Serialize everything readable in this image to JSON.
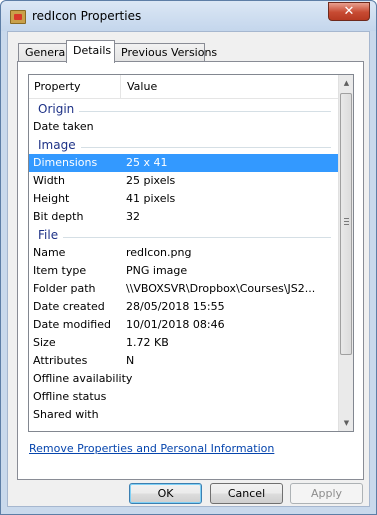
{
  "window": {
    "title": "redIcon Properties",
    "close_glyph": "✕"
  },
  "tabs": [
    {
      "label": "General"
    },
    {
      "label": "Details"
    },
    {
      "label": "Previous Versions"
    }
  ],
  "columns": {
    "property": "Property",
    "value": "Value"
  },
  "groups": [
    {
      "label": "Origin",
      "rows": [
        {
          "key": "Date taken",
          "value": ""
        }
      ]
    },
    {
      "label": "Image",
      "rows": [
        {
          "key": "Dimensions",
          "value": "25 x 41"
        },
        {
          "key": "Width",
          "value": "25 pixels"
        },
        {
          "key": "Height",
          "value": "41 pixels"
        },
        {
          "key": "Bit depth",
          "value": "32"
        }
      ]
    },
    {
      "label": "File",
      "rows": [
        {
          "key": "Name",
          "value": "redIcon.png"
        },
        {
          "key": "Item type",
          "value": "PNG image"
        },
        {
          "key": "Folder path",
          "value": "\\\\VBOXSVR\\Dropbox\\Courses\\JS2..."
        },
        {
          "key": "Date created",
          "value": "28/05/2018 15:55"
        },
        {
          "key": "Date modified",
          "value": "10/01/2018 08:46"
        },
        {
          "key": "Size",
          "value": "1.72 KB"
        },
        {
          "key": "Attributes",
          "value": "N"
        },
        {
          "key": "Offline availability",
          "value": ""
        },
        {
          "key": "Offline status",
          "value": ""
        },
        {
          "key": "Shared with",
          "value": ""
        }
      ]
    }
  ],
  "remove_link": "Remove Properties and Personal Information",
  "buttons": {
    "ok": "OK",
    "cancel": "Cancel",
    "apply": "Apply"
  },
  "colors": {
    "selection": "#3399ff",
    "group_text": "#1e3287",
    "link": "#0645ad"
  },
  "icons": {
    "title": "image-file-icon",
    "scroll_up": "arrow-up-icon",
    "scroll_down": "arrow-down-icon"
  }
}
